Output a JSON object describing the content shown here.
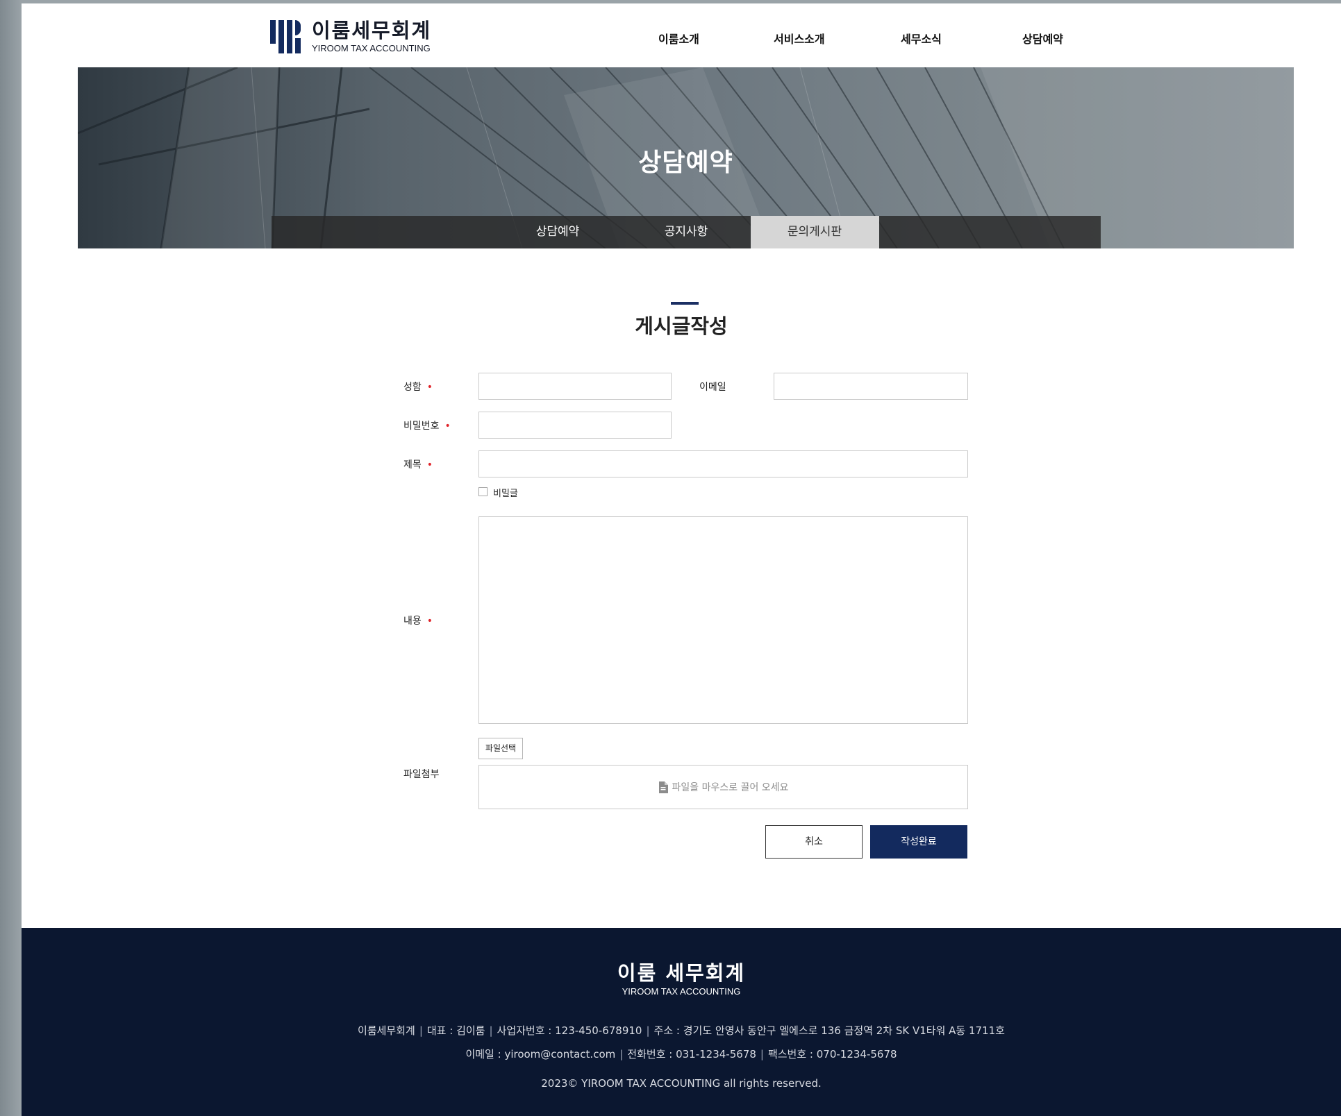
{
  "header": {
    "logo_ko": "이룸세무회계",
    "logo_en": "YIROOM TAX ACCOUNTING",
    "nav": [
      "이룸소개",
      "서비스소개",
      "세무소식",
      "상담예약"
    ]
  },
  "hero": {
    "title": "상담예약",
    "tabs": [
      "상담예약",
      "공지사항",
      "문의게시판"
    ],
    "active_tab": "문의게시판"
  },
  "form": {
    "title": "게시글작성",
    "name_label": "성함",
    "email_label": "이메일",
    "password_label": "비밀번호",
    "subject_label": "제목",
    "secret_label": "비밀글",
    "content_label": "내용",
    "attach_label": "파일첨부",
    "file_button": "파일선택",
    "drop_hint": "파일을 마우스로 끌어 오세요",
    "required_mark": "•",
    "name_value": "",
    "email_value": "",
    "password_value": "",
    "subject_value": "",
    "content_value": "",
    "secret_checked": false,
    "cancel_label": "취소",
    "submit_label": "작성완료"
  },
  "footer": {
    "logo_ko": "이룸 세무회계",
    "logo_en": "YIROOM TAX ACCOUNTING",
    "company": "이룸세무회계",
    "ceo": "대표 : 김이룸",
    "biz_no": "사업자번호 : 123-450-678910",
    "address": "주소 : 경기도 안영사 동안구 엘에스로 136 금정역 2차 SK V1타워 A동 1711호",
    "email": "이메일 : yiroom@contact.com",
    "phone": "전화번호 : 031-1234-5678",
    "fax": "팩스번호 : 070-1234-5678",
    "copyright": "2023© YIROOM TAX ACCOUNTING all rights reserved.",
    "separator": "|"
  },
  "colors": {
    "brand_navy": "#132a5e",
    "footer_bg": "#0b1730",
    "required_red": "#e0242a"
  }
}
